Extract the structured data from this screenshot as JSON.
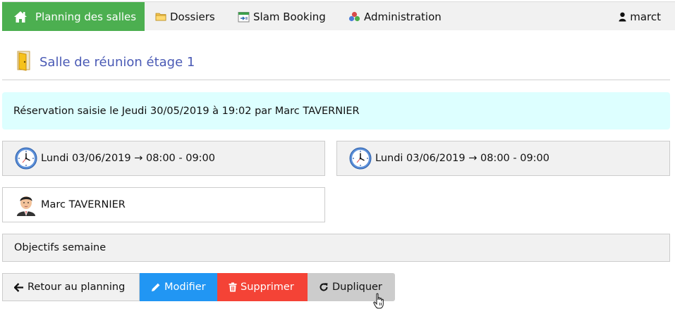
{
  "nav": {
    "home_label": "Planning des salles",
    "folders_label": "Dossiers",
    "slam_label": "Slam Booking",
    "admin_label": "Administration",
    "user_label": "marct"
  },
  "page": {
    "title": "Salle de réunion étage 1"
  },
  "info": {
    "text": "Réservation saisie le Jeudi 30/05/2019 à 19:02 par Marc TAVERNIER"
  },
  "booking": {
    "start": "Lundi 03/06/2019 → 08:00 - 09:00",
    "end": "Lundi 03/06/2019 → 08:00 - 09:00",
    "person": "Marc TAVERNIER",
    "description": "Objectifs semaine"
  },
  "actions": {
    "back_label": "Retour au planning",
    "edit_label": "Modifier",
    "delete_label": "Supprimer",
    "duplicate_label": "Dupliquer"
  },
  "colors": {
    "home_green": "#4caf50",
    "title_blue": "#4a5ab5",
    "info_bg": "#ddffff",
    "edit_blue": "#2196f3",
    "delete_red": "#f44336"
  },
  "icons": {
    "home": "home-icon",
    "folders": "folder-icon",
    "slam": "calendar-icon",
    "admin": "admin-molecule-icon",
    "user": "user-icon",
    "door": "door-icon",
    "clock": "clock-icon",
    "person": "person-avatar-icon",
    "back": "arrow-left-icon",
    "edit": "pencil-icon",
    "delete": "trash-icon",
    "duplicate": "refresh-icon"
  }
}
